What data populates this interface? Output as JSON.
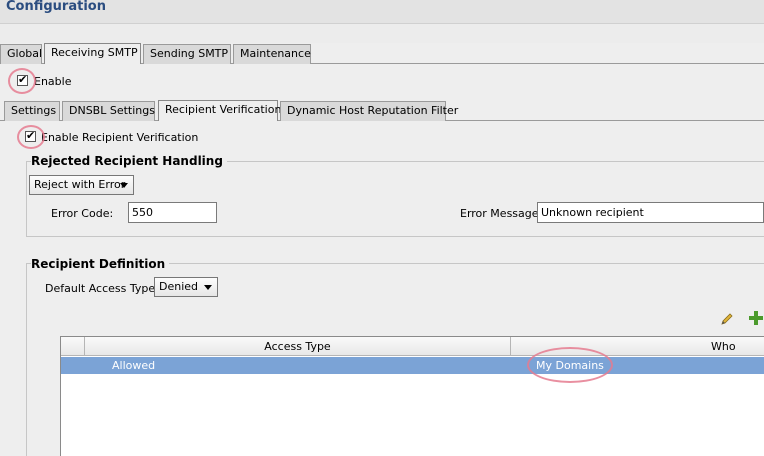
{
  "header": {
    "title": "Configuration"
  },
  "top_tabs": [
    "Global",
    "Receiving SMTP",
    "Sending SMTP",
    "Maintenance"
  ],
  "enable": {
    "label": "Enable",
    "checked": true
  },
  "sub_tabs": [
    "Settings",
    "DNSBL Settings",
    "Recipient Verification",
    "Dynamic Host Reputation Filter"
  ],
  "recipient_verification": {
    "enable_label": "Enable Recipient Verification",
    "checked": true,
    "rejected_group": {
      "title": "Rejected Recipient Handling",
      "action_value": "Reject with Error",
      "error_code_label": "Error Code:",
      "error_code_value": "550",
      "error_message_label": "Error Message:",
      "error_message_value": "Unknown recipient"
    },
    "definition_group": {
      "title": "Recipient Definition",
      "default_access_label": "Default Access Type:",
      "default_access_value": "Denied",
      "table": {
        "columns": [
          "Access Type",
          "Who"
        ],
        "rows": [
          {
            "access_type": "Allowed",
            "who": "My Domains"
          }
        ]
      }
    }
  },
  "icons": {
    "edit": "pencil-icon",
    "add": "plus-icon"
  },
  "colors": {
    "title": "#2b4d80",
    "selected_row": "#7ba3d6",
    "annotation": "#e57b8f"
  }
}
